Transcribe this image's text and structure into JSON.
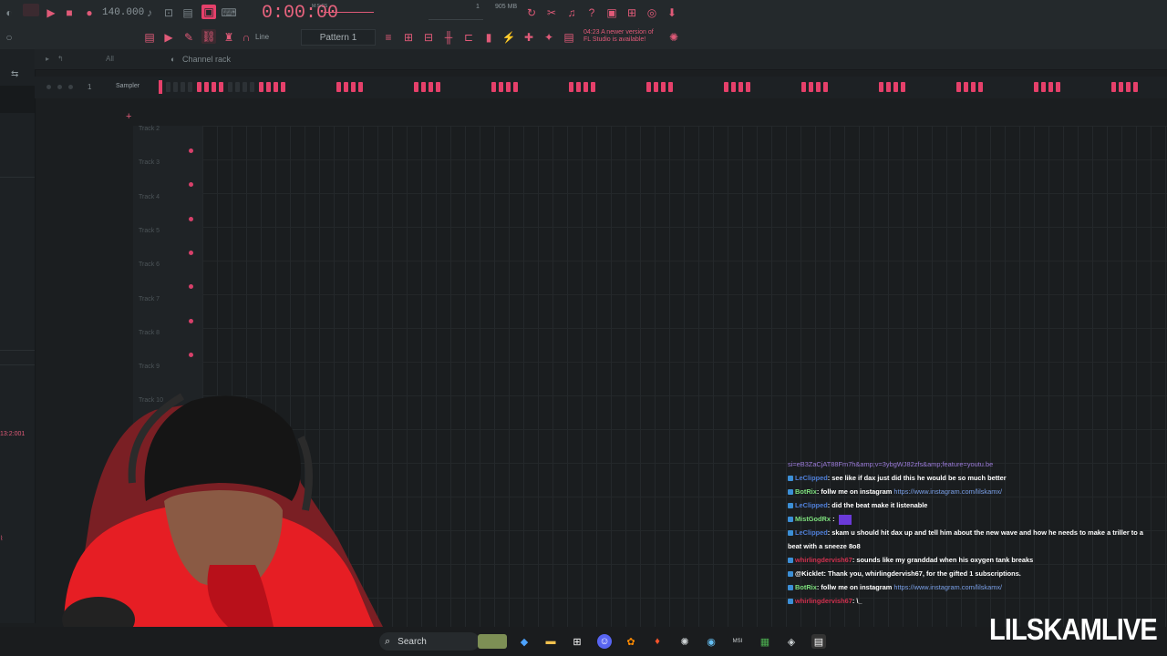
{
  "toolbar": {
    "tempo": "140.000",
    "time": "0:00:00",
    "time_unit": "M:S:CS",
    "memory": "905 MB",
    "voices": "1",
    "pattern": "Pattern 1",
    "snap": "Line",
    "news_line1": "04:23  A newer version of",
    "news_line2": "FL Studio is available!"
  },
  "channel_rack": {
    "title": "Channel rack",
    "filter": "All",
    "channel_number": "1",
    "channel_name": "Sampler"
  },
  "playlist": {
    "tracks": [
      "Track 2",
      "Track 3",
      "Track 4",
      "Track 5",
      "Track 6",
      "Track 7",
      "Track 8",
      "Track 9",
      "Track 10"
    ]
  },
  "side_readout": "13:2:001",
  "chat": {
    "top_link": "si=eB3ZaCjAT88Fm7h&amp;v=3ybgWJ82zfs&amp;feature=youtu.be",
    "messages": [
      {
        "user": "LeClipped",
        "user_class": "u-blue",
        "text": ": see like if dax just did this he would be so much better",
        "link": ""
      },
      {
        "user": "BotRix",
        "user_class": "u-green",
        "text": ": follw me on instagram ",
        "link": "https://www.instagram.com/lilskamx/"
      },
      {
        "user": "LeClipped",
        "user_class": "u-blue",
        "text": ": did the beat make it listenable",
        "link": ""
      },
      {
        "user": "MistGodRx",
        "user_class": "u-green",
        "text": " : ",
        "link": ""
      },
      {
        "user": "LeClipped",
        "user_class": "u-blue",
        "text": ": skam u should hit dax up and tell him about the new wave and how he needs to make a triller to a",
        "link": ""
      },
      {
        "user": "",
        "user_class": "",
        "text": "beat with a sneeze 8o8",
        "link": ""
      },
      {
        "user": "whirlingdervish67",
        "user_class": "u-red",
        "text": ": sounds like my granddad when his oxygen tank breaks",
        "link": ""
      },
      {
        "user": "@Kicklet",
        "user_class": "",
        "text": ": Thank you, whirlingdervish67, for the gifted 1 subscriptions.",
        "link": ""
      },
      {
        "user": "BotRix",
        "user_class": "u-green",
        "text": ": follw me on instagram ",
        "link": "https://www.instagram.com/lilskamx/"
      },
      {
        "user": "whirlingdervish67",
        "user_class": "u-red",
        "text": ": \\_",
        "link": ""
      }
    ]
  },
  "taskbar": {
    "search_label": "Search"
  },
  "watermark": "LILSKAMLIVE",
  "colors": {
    "accent": "#e5406a",
    "background": "#1b1e20",
    "chat_link": "#7aa0e8"
  }
}
